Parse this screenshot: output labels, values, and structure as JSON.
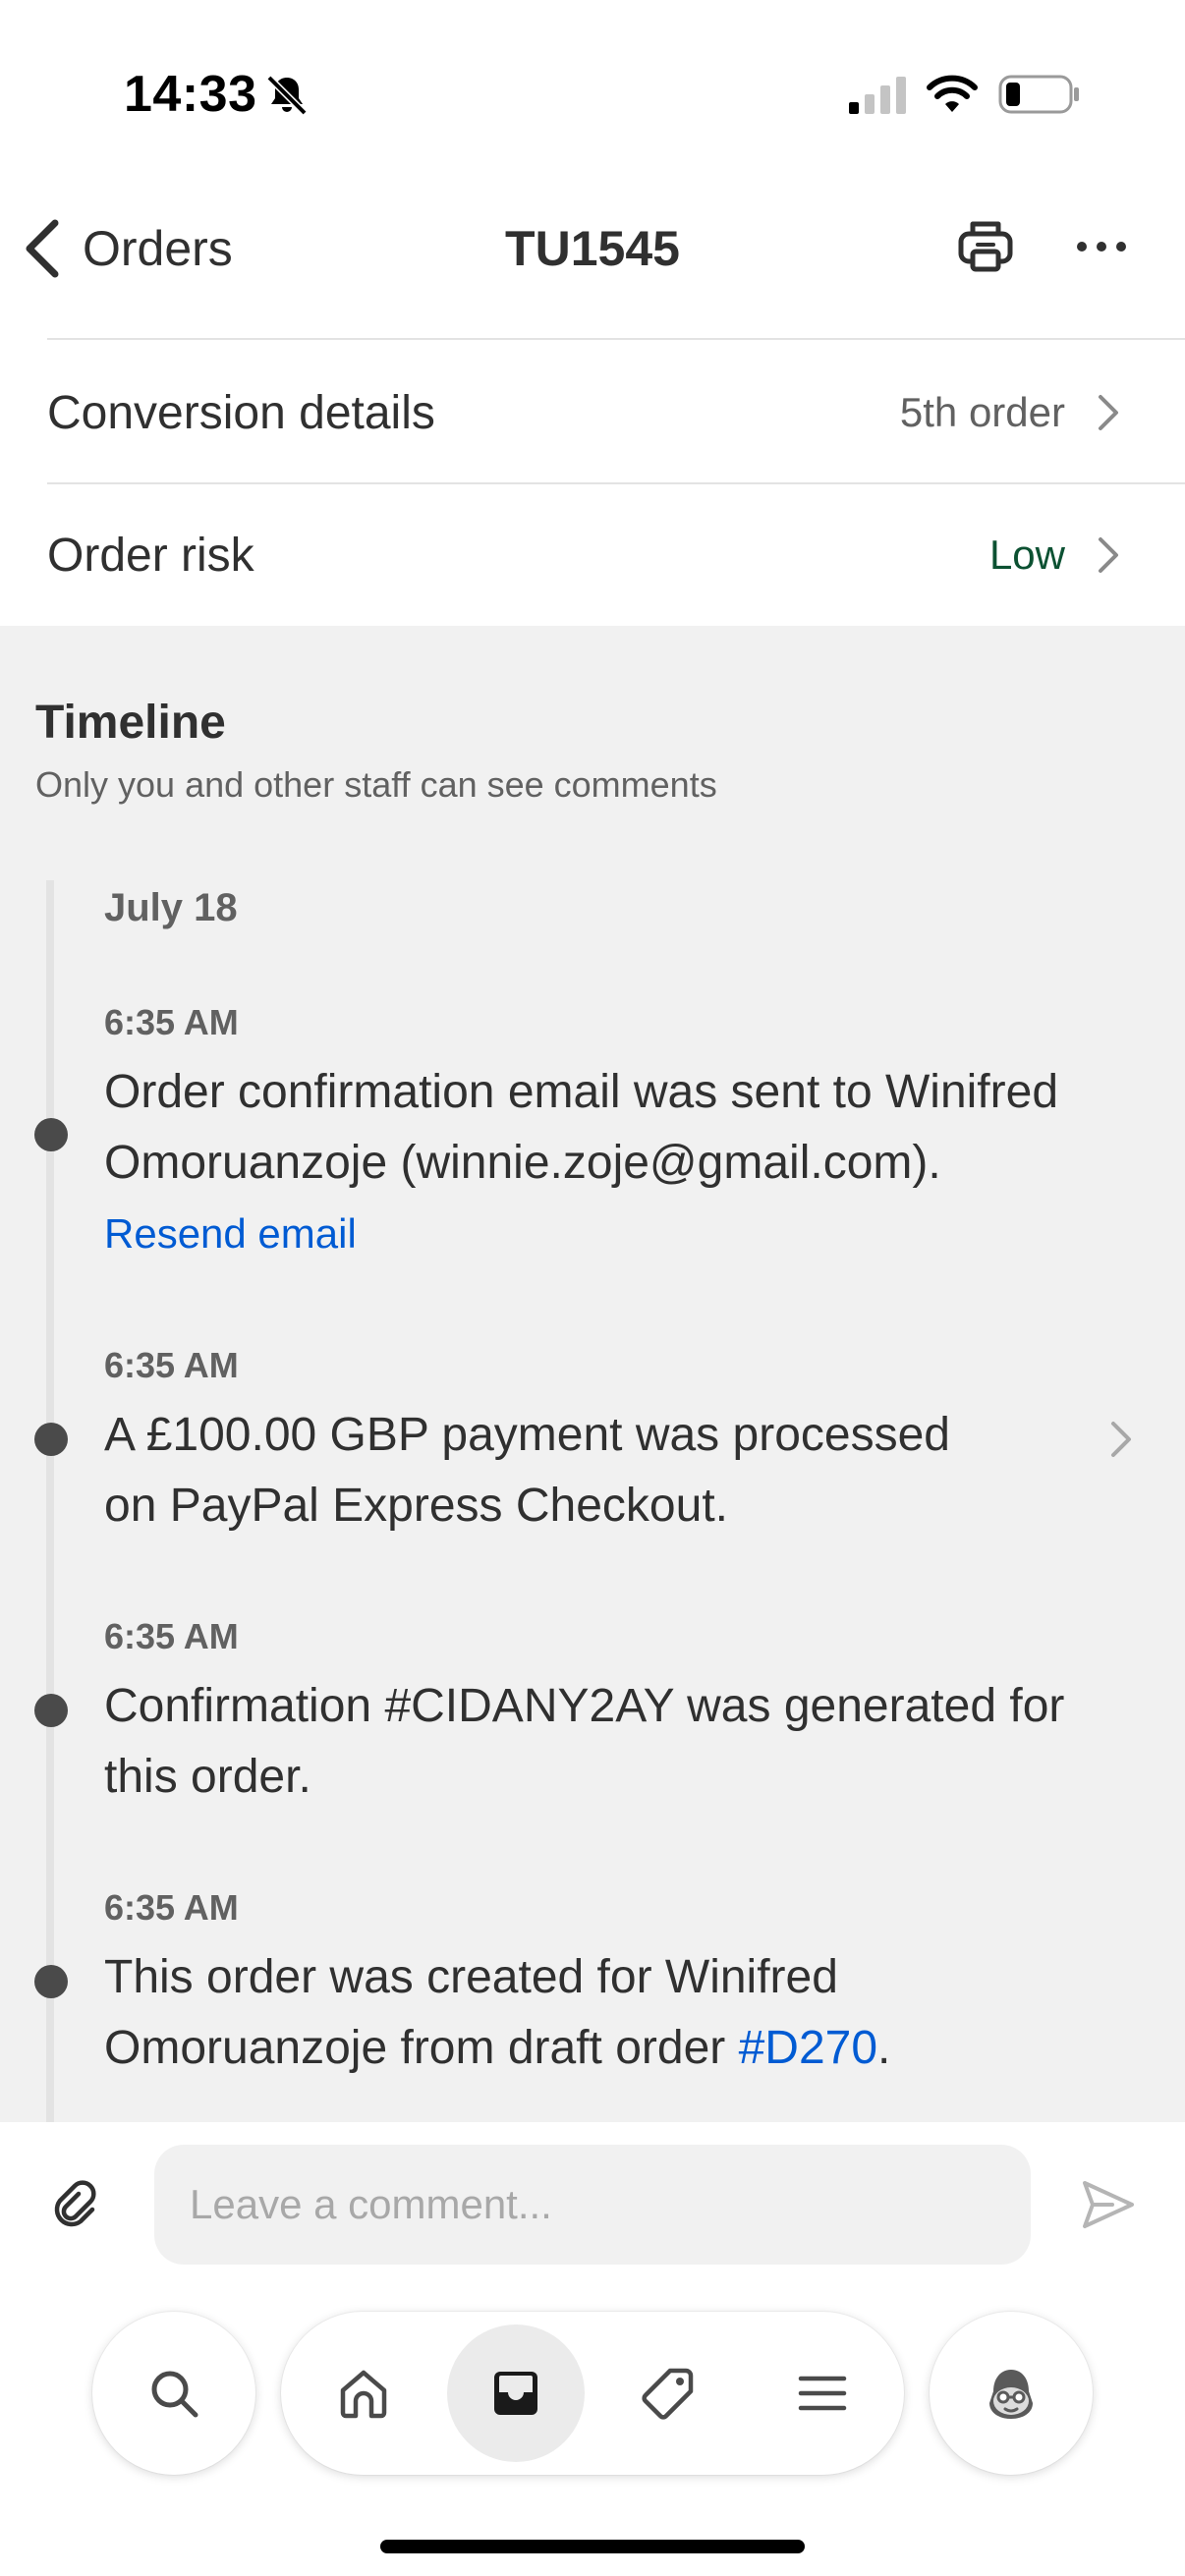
{
  "status_bar": {
    "time": "14:33"
  },
  "nav": {
    "back_label": "Orders",
    "title": "TU1545"
  },
  "details": [
    {
      "label": "Conversion details",
      "value": "5th order"
    },
    {
      "label": "Order risk",
      "value": "Low"
    }
  ],
  "timeline": {
    "heading": "Timeline",
    "subtitle": "Only you and other staff can see comments",
    "date": "July 18",
    "events": [
      {
        "time": "6:35 AM",
        "text": "Order confirmation email was sent to Winifred Omoruanzoje (winnie.zoje@gmail.com).",
        "action": "Resend email"
      },
      {
        "time": "6:35 AM",
        "text_line1": "A £100.00 GBP payment was processed",
        "text_line2": "on PayPal Express Checkout."
      },
      {
        "time": "6:35 AM",
        "text": "Confirmation #CIDANY2AY was generated for this order."
      },
      {
        "time": "6:35 AM",
        "text_prefix": "This order was created for Winifred Omoruanzoje from draft order ",
        "link": "#D270",
        "text_suffix": "."
      }
    ]
  },
  "comment": {
    "placeholder": "Leave a comment..."
  },
  "colors": {
    "link": "#005bd3",
    "risk_low": "#0c5132",
    "timeline_background": "#f1f1f1"
  }
}
